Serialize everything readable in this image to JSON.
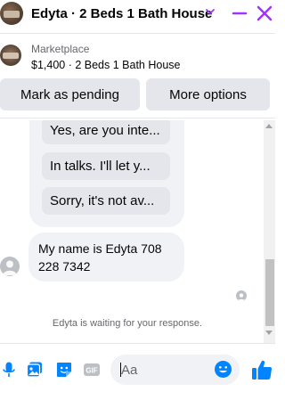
{
  "header": {
    "title": "Edyta · 2 Beds 1 Bath House",
    "accent": "#a033ff"
  },
  "listing": {
    "label": "Marketplace",
    "summary": "$1,400 · 2 Beds 1 Bath House"
  },
  "actions": {
    "mark_pending": "Mark as pending",
    "more_options": "More options"
  },
  "chat": {
    "quick_replies": [
      "Yes, are you inte...",
      "In talks. I'll let y...",
      "Sorry, it's not av..."
    ],
    "message": "My name is Edyta 708 228 7342",
    "waiting_status": "Edyta is waiting for your response."
  },
  "composer": {
    "placeholder": "Aa",
    "icons": [
      "microphone-icon",
      "photo-icon",
      "sticker-icon",
      "gif-icon",
      "emoji-icon",
      "thumbs-up-icon"
    ],
    "brand_color": "#0084ff"
  }
}
